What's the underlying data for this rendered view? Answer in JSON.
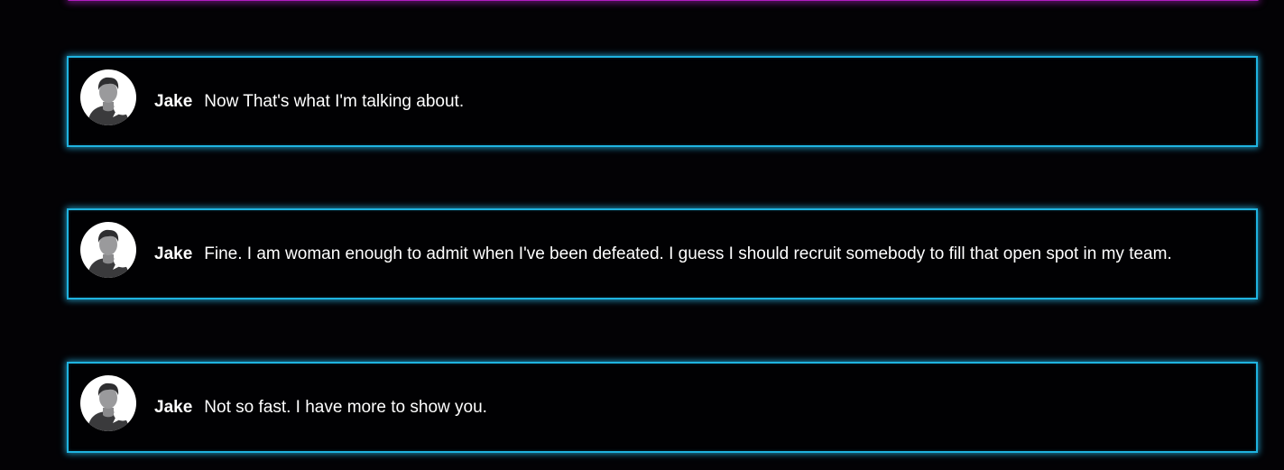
{
  "messages": [
    {
      "speaker": "Jake",
      "text": "Now That's what I'm talking about."
    },
    {
      "speaker": "Jake",
      "text": "Fine. I am woman enough to admit when I've been defeated. I guess I should recruit somebody to fill that open spot in my team."
    },
    {
      "speaker": "Jake",
      "text": "Not so fast. I have more to show you."
    }
  ],
  "colors": {
    "background": "#030205",
    "box_border": "#1fb3e0",
    "top_border": "#b01cc0",
    "text": "#ffffff"
  },
  "icons": {
    "avatar": "user-avatar-icon",
    "bubble": "speech-bubble-icon"
  }
}
